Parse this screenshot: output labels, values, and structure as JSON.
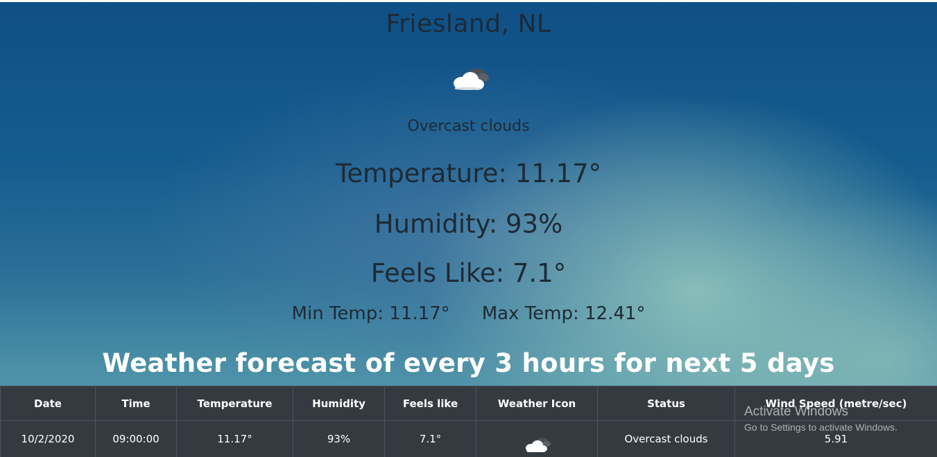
{
  "location": {
    "city": "Friesland, NL"
  },
  "current": {
    "icon": "cloud-overcast-icon",
    "description": "Overcast clouds",
    "temperature": "Temperature: 11.17°",
    "humidity": "Humidity: 93%",
    "feels_like": "Feels Like: 7.1°",
    "min_temp": "Min Temp: 11.17°",
    "max_temp": "Max Temp: 12.41°"
  },
  "forecast": {
    "title": "Weather forecast of every 3 hours for next 5 days",
    "columns": [
      "Date",
      "Time",
      "Temperature",
      "Humidity",
      "Feels like",
      "Weather Icon",
      "Status",
      "Wind Speed (metre/sec)"
    ],
    "rows": [
      {
        "date": "10/2/2020",
        "time": "09:00:00",
        "temperature": "11.17°",
        "humidity": "93%",
        "feels_like": "7.1°",
        "icon": "cloud-overcast-icon",
        "status": "Overcast clouds",
        "wind_speed": "5.91"
      }
    ]
  },
  "watermark": {
    "title": "Activate Windows",
    "subtitle": "Go to Settings to activate Windows."
  },
  "colors": {
    "table_background": "#343a40",
    "heading_white": "#ffffff",
    "text_dark": "#1d2a36"
  }
}
